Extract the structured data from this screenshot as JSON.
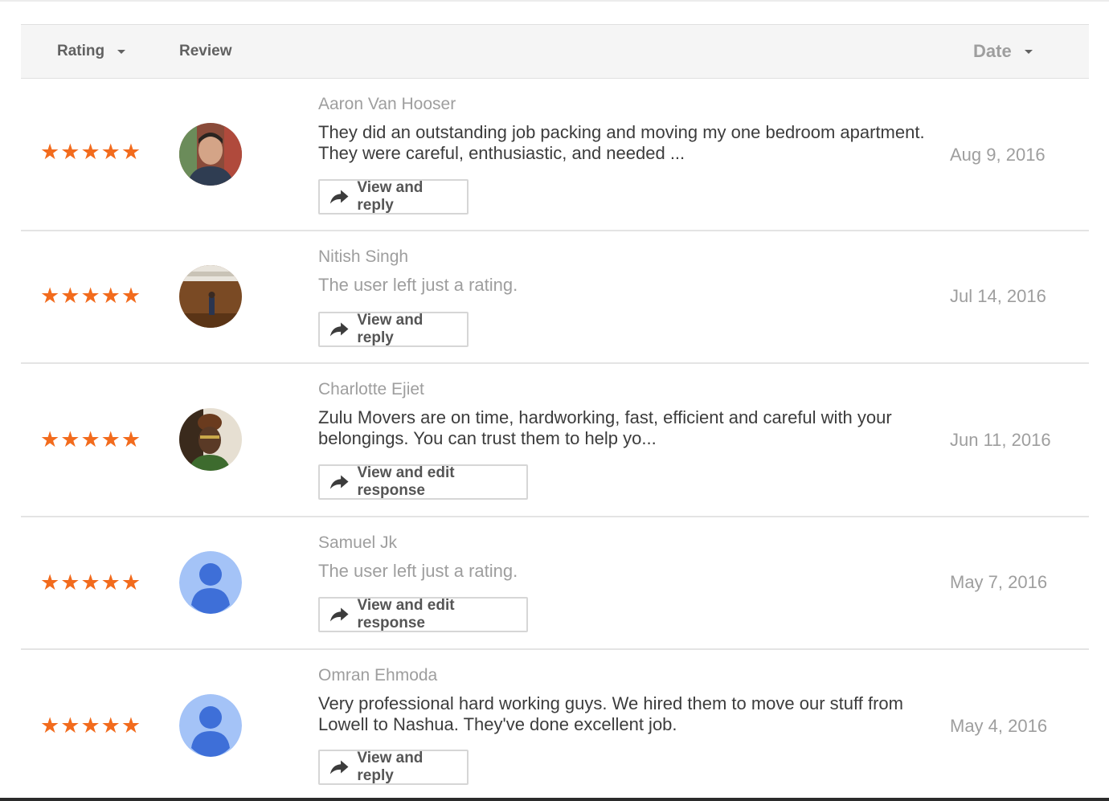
{
  "header": {
    "rating_label": "Rating",
    "review_label": "Review",
    "date_label": "Date"
  },
  "star_glyph": "★",
  "accent_star_color": "#f26b1d",
  "reviews": [
    {
      "name": "Aaron Van Hooser",
      "text": "They did an outstanding job packing and moving my one bedroom apartment. They were careful, enthusiastic, and needed ...",
      "button": "View and reply",
      "date": "Aug 9, 2016",
      "rating": 5,
      "avatar": "man-photo"
    },
    {
      "name": "Nitish Singh",
      "text": "The user left just a rating.",
      "button": "View and reply",
      "date": "Jul 14, 2016",
      "rating": 5,
      "avatar": "stage-photo"
    },
    {
      "name": "Charlotte Ejiet",
      "text": "Zulu Movers are on time, hardworking, fast, efficient and careful with your belongings. You can trust them to help yo...",
      "button": "View and edit response",
      "date": "Jun 11, 2016",
      "rating": 5,
      "avatar": "woman-photo"
    },
    {
      "name": "Samuel Jk",
      "text": "The user left just a rating.",
      "button": "View and edit response",
      "date": "May 7, 2016",
      "rating": 5,
      "avatar": "default-user-icon"
    },
    {
      "name": "Omran Ehmoda",
      "text": "Very professional hard working guys. We hired them to move our stuff from Lowell to Nashua. They've done excellent job.",
      "button": "View and reply",
      "date": "May 4, 2016",
      "rating": 5,
      "avatar": "default-user-icon"
    }
  ]
}
